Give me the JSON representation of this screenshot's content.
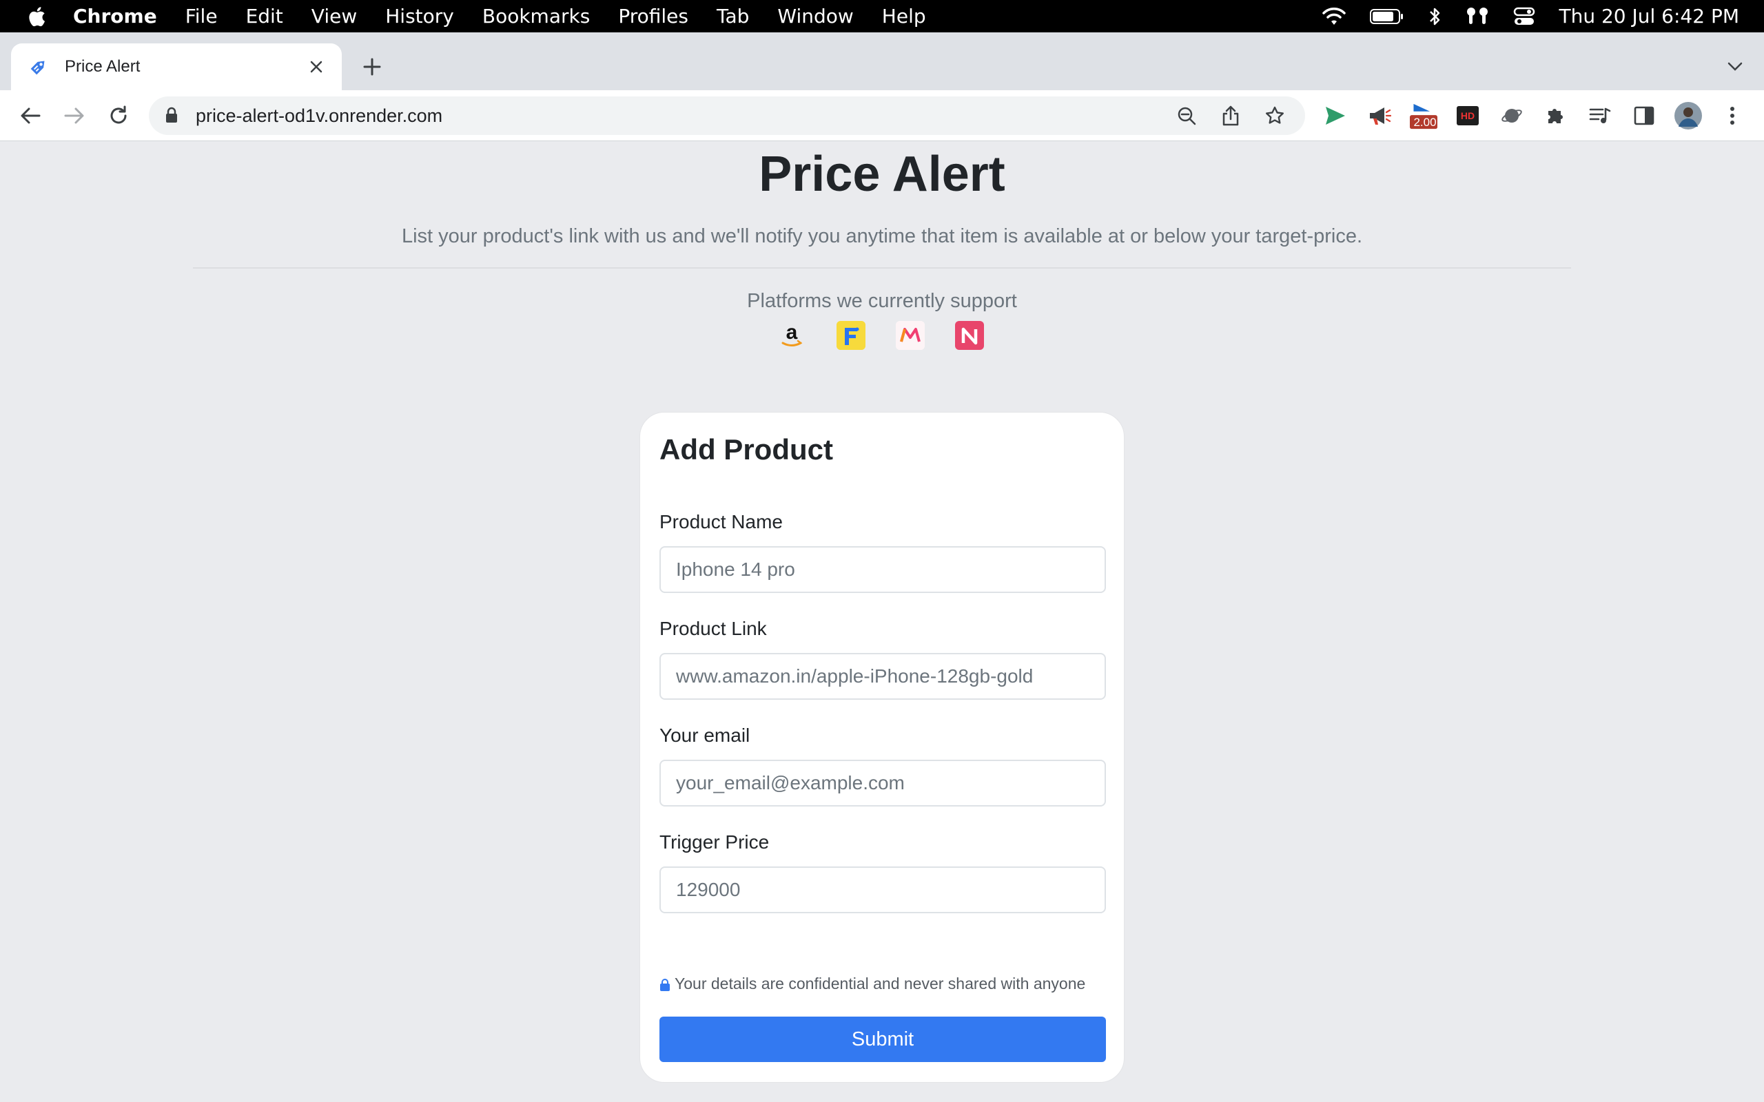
{
  "menubar": {
    "app_name": "Chrome",
    "items": [
      "File",
      "Edit",
      "View",
      "History",
      "Bookmarks",
      "Profiles",
      "Tab",
      "Window",
      "Help"
    ],
    "clock": "Thu 20 Jul  6:42 PM"
  },
  "browser": {
    "tab_title": "Price Alert",
    "url": "price-alert-od1v.onrender.com",
    "extension_badge": "2.00",
    "hd_badge": "HD"
  },
  "page": {
    "title": "Price Alert",
    "subtitle": "List your product's link with us and we'll notify you anytime that item is available at or below your target-price.",
    "platforms_label": "Platforms we currently support",
    "platforms": [
      "amazon",
      "flipkart",
      "myntra",
      "nykaa"
    ]
  },
  "form": {
    "title": "Add Product",
    "product_name": {
      "label": "Product Name",
      "placeholder": "Iphone 14 pro"
    },
    "product_link": {
      "label": "Product Link",
      "placeholder": "www.amazon.in/apple-iPhone-128gb-gold"
    },
    "email": {
      "label": "Your email",
      "placeholder": "your_email@example.com"
    },
    "trigger_price": {
      "label": "Trigger Price",
      "placeholder": "129000"
    },
    "privacy_note": "Your details are confidential and never shared with anyone",
    "submit_label": "Submit"
  },
  "colors": {
    "primary": "#3379f1",
    "page_bg": "#eaebee",
    "text_dark": "#212529",
    "text_muted": "#6c757d"
  }
}
